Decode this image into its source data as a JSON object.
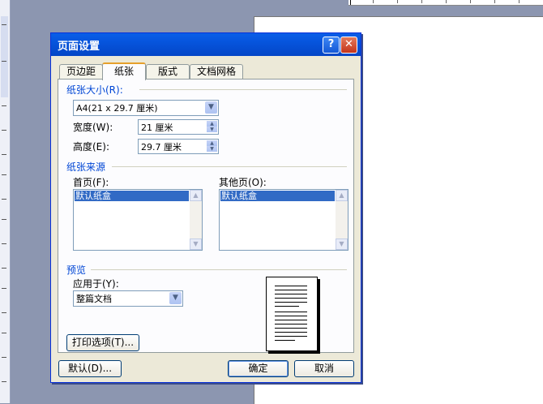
{
  "dialog": {
    "title": "页面设置",
    "help_glyph": "?",
    "close_glyph": "✕"
  },
  "tabs": [
    {
      "label": "页边距",
      "active": false
    },
    {
      "label": "纸张",
      "active": true
    },
    {
      "label": "版式",
      "active": false
    },
    {
      "label": "文档网格",
      "active": false
    }
  ],
  "paper_size": {
    "group_label": "纸张大小(R):",
    "selected": "A4(21 x 29.7 厘米)",
    "width_label": "宽度(W):",
    "width_value": "21 厘米",
    "height_label": "高度(E):",
    "height_value": "29.7 厘米"
  },
  "paper_source": {
    "group_label": "纸张来源",
    "first_page_label": "首页(F):",
    "first_page_selected": "默认纸盒",
    "other_pages_label": "其他页(O):",
    "other_pages_selected": "默认纸盒"
  },
  "preview": {
    "group_label": "预览",
    "apply_to_label": "应用于(Y):",
    "apply_to_value": "整篇文档"
  },
  "buttons": {
    "print_options": "打印选项(T)...",
    "default": "默认(D)...",
    "ok": "确定",
    "cancel": "取消"
  },
  "colors": {
    "titlebar": "#0654dc",
    "group_label": "#0046d5",
    "selection": "#316ac5",
    "dialog_bg": "#ece9d8"
  }
}
